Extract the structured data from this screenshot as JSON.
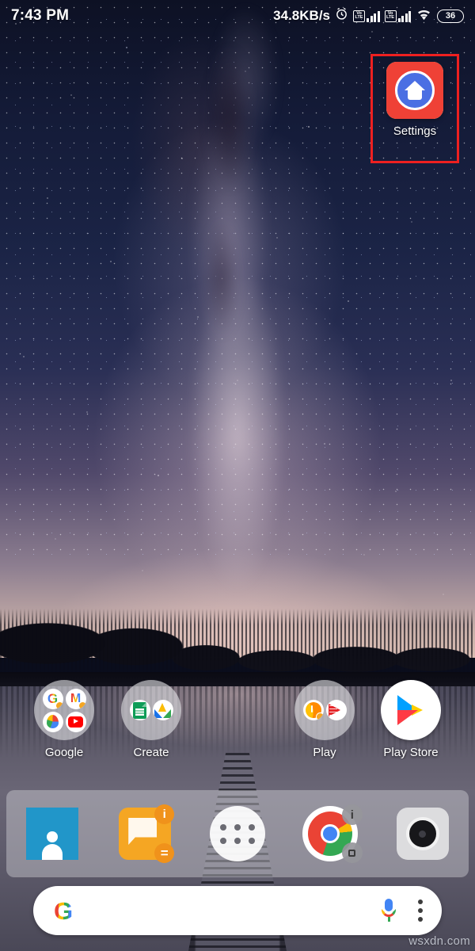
{
  "status_bar": {
    "time": "7:43 PM",
    "network_speed": "34.8KB/s",
    "alarm_icon": "alarm-clock-icon",
    "sim1": {
      "volte_top": "Vo",
      "volte_bottom": "LTE",
      "signal_icon": "signal-bars-icon"
    },
    "sim2": {
      "volte_top": "Vo",
      "volte_bottom": "LTE",
      "signal_icon": "signal-bars-icon"
    },
    "wifi_icon": "wifi-icon",
    "battery_level": "36"
  },
  "highlight": {
    "color": "#ee2020",
    "target": "Settings"
  },
  "home_screen": {
    "settings_app": {
      "label": "Settings",
      "icon": "settings-home-icon"
    },
    "row": [
      {
        "label": "Google",
        "type": "folder",
        "apps": [
          {
            "name": "Google",
            "icon": "google-g-icon",
            "glyph": "G"
          },
          {
            "name": "Gmail",
            "icon": "gmail-icon",
            "glyph": "M"
          },
          {
            "name": "Maps",
            "icon": "google-maps-icon"
          },
          {
            "name": "YouTube",
            "icon": "youtube-icon"
          }
        ]
      },
      {
        "label": "Create",
        "type": "folder",
        "apps": [
          {
            "name": "Sheets",
            "icon": "google-sheets-icon"
          },
          {
            "name": "Drive",
            "icon": "google-drive-icon"
          }
        ]
      },
      {
        "label": "Play",
        "type": "folder",
        "apps": [
          {
            "name": "Play Music",
            "icon": "play-music-icon"
          },
          {
            "name": "Play Movies",
            "icon": "play-movies-icon"
          }
        ]
      },
      {
        "label": "Play Store",
        "type": "app",
        "icon": "play-store-icon"
      }
    ]
  },
  "dock": {
    "items": [
      {
        "name": "Contacts",
        "icon": "contacts-icon"
      },
      {
        "name": "Messaging",
        "icon": "messaging-icon",
        "badge_top": "i",
        "badge_bottom": "="
      },
      {
        "name": "App Drawer",
        "icon": "app-drawer-icon"
      },
      {
        "name": "Chrome",
        "icon": "chrome-icon",
        "badge_top": "i",
        "badge_bottom": "stop-square-icon"
      },
      {
        "name": "Camera",
        "icon": "camera-icon"
      }
    ]
  },
  "search_bar": {
    "logo_glyph": "G",
    "logo_icon": "google-g-icon",
    "query": "",
    "placeholder": "",
    "mic_icon": "microphone-icon",
    "menu_icon": "three-dot-menu-icon"
  },
  "watermark": {
    "text": "wsxdn.com"
  },
  "colors": {
    "highlight_red": "#ee2020",
    "dock_panel": "rgba(214,214,220,0.42)",
    "search_bar_bg": "#ffffff"
  }
}
